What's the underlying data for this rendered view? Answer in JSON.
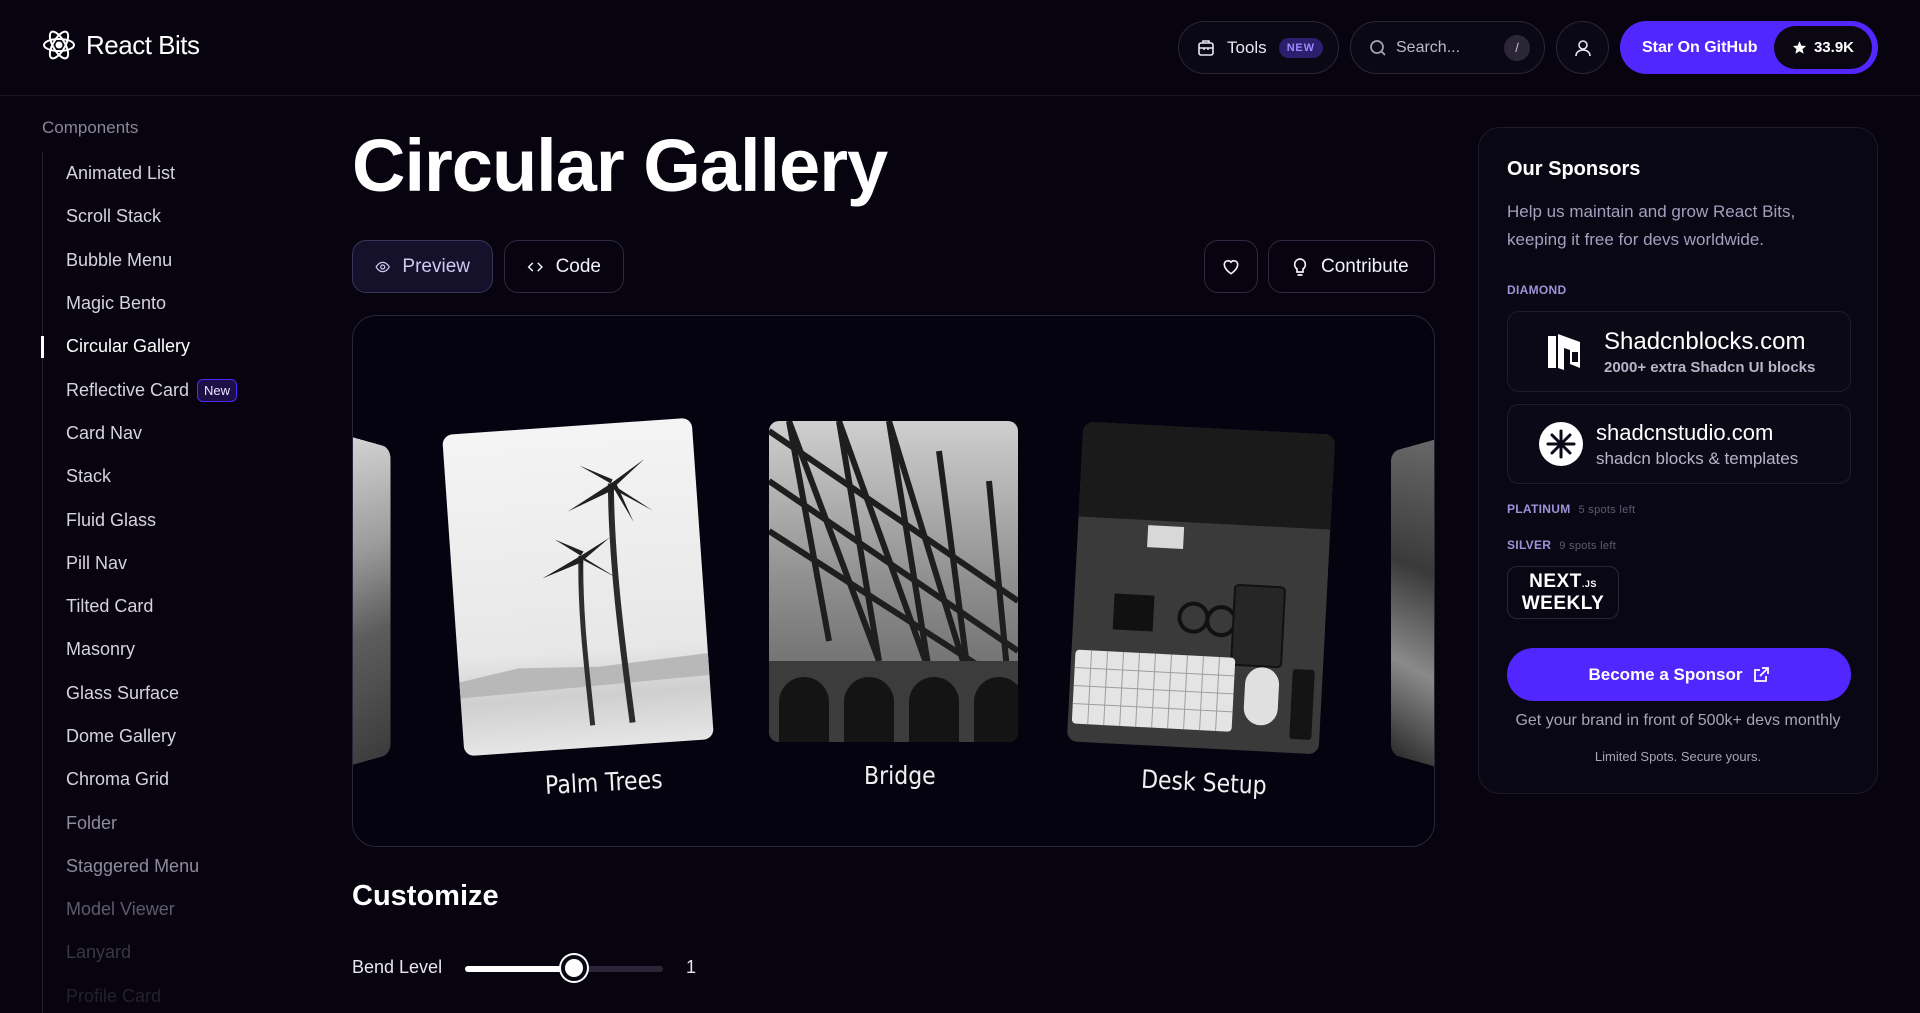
{
  "header": {
    "brand": "React Bits",
    "tools_label": "Tools",
    "tools_badge": "NEW",
    "search_placeholder": "Search...",
    "search_shortcut": "/",
    "github_label": "Star On GitHub",
    "github_stars": "33.9K"
  },
  "sidebar": {
    "heading": "Components",
    "items": [
      {
        "label": "Animated List"
      },
      {
        "label": "Scroll Stack"
      },
      {
        "label": "Bubble Menu"
      },
      {
        "label": "Magic Bento"
      },
      {
        "label": "Circular Gallery",
        "active": true
      },
      {
        "label": "Reflective Card",
        "badge": "New"
      },
      {
        "label": "Card Nav"
      },
      {
        "label": "Stack"
      },
      {
        "label": "Fluid Glass"
      },
      {
        "label": "Pill Nav"
      },
      {
        "label": "Tilted Card"
      },
      {
        "label": "Masonry"
      },
      {
        "label": "Glass Surface"
      },
      {
        "label": "Dome Gallery"
      },
      {
        "label": "Chroma Grid"
      },
      {
        "label": "Folder"
      },
      {
        "label": "Staggered Menu"
      },
      {
        "label": "Model Viewer"
      },
      {
        "label": "Lanyard"
      },
      {
        "label": "Profile Card"
      }
    ]
  },
  "main": {
    "title": "Circular Gallery",
    "tabs": {
      "preview": "Preview",
      "code": "Code"
    },
    "contribute_label": "Contribute",
    "gallery": {
      "cards": [
        "Palm Trees",
        "Bridge",
        "Desk Setup"
      ]
    },
    "customize": {
      "title": "Customize",
      "bend_label": "Bend Level",
      "bend_value": "1",
      "bend_fraction": 0.55
    }
  },
  "sponsors": {
    "title": "Our Sponsors",
    "subtitle": "Help us maintain and grow React Bits, keeping it free for devs worldwide.",
    "diamond_label": "DIAMOND",
    "diamond": [
      {
        "name": "Shadcnblocks.com",
        "desc": "2000+ extra Shadcn UI blocks"
      },
      {
        "name": "shadcnstudio.com",
        "desc": "shadcn blocks & templates"
      }
    ],
    "platinum_label": "PLATINUM",
    "platinum_spots": "5 spots left",
    "silver_label": "SILVER",
    "silver_spots": "9 spots left",
    "silver_sponsor": {
      "line1": "NEXT",
      "line1_suffix": ".JS",
      "line2": "WEEKLY"
    },
    "cta_label": "Become a Sponsor",
    "note": "Get your brand in front of 500k+ devs monthly",
    "note_small": "Limited Spots. Secure yours."
  },
  "colors": {
    "background": "#07040f",
    "accent": "#5227ff",
    "border": "#2a2638"
  }
}
